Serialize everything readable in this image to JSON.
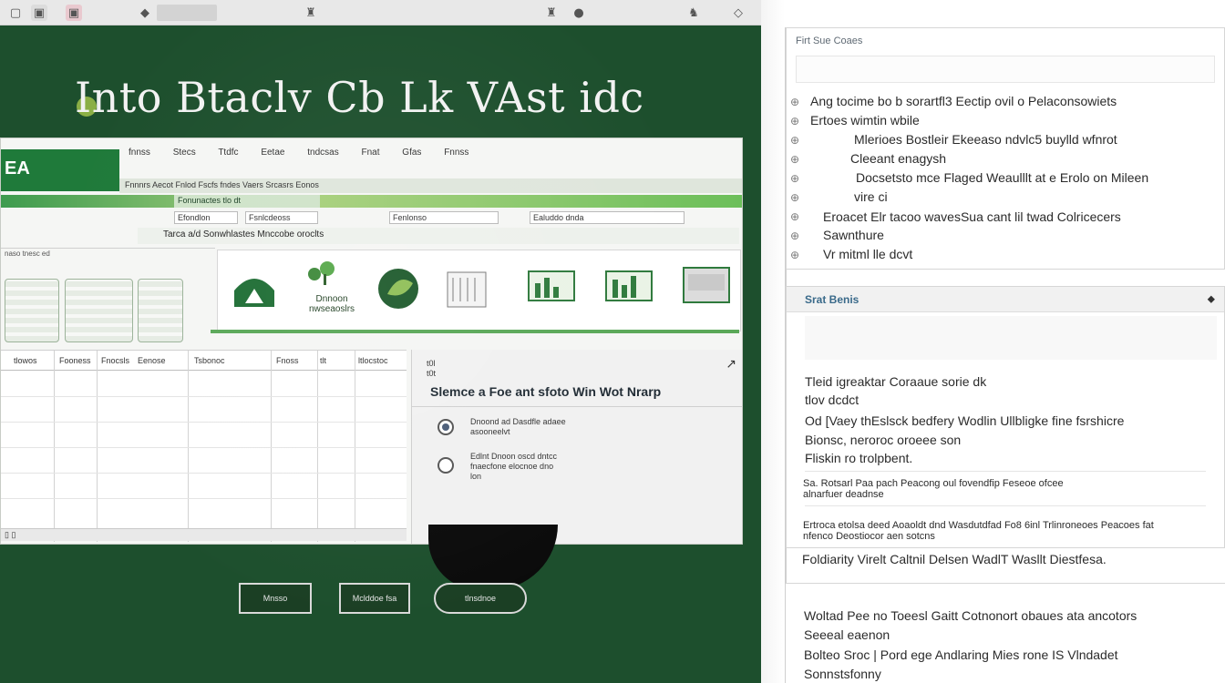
{
  "headline": "Into Btaclv Cb Lk VAst idc",
  "topbar": {
    "icons": [
      "app-icon",
      "tile-icon",
      "tile-icon",
      "bell-icon",
      "pin-icon",
      "bookmark-icon",
      "settings-icon",
      "lamp-icon",
      "menu-icon"
    ]
  },
  "app": {
    "logo_text": "EA",
    "menu": [
      "fnnss",
      "Stecs",
      "Ttdfc",
      "Eetae",
      "tndcsas",
      "Fnat",
      "Gfas",
      "Fnnss"
    ],
    "ribbon": "Fnnnrs   Aecot   Fnlod    Fscfs   fndes   Vaers   Srcasrs   Eonos",
    "tab": "Fonunactes   tlo   dt",
    "fields": [
      "Efondlon",
      "Fsnlcdeoss",
      "Fenlonso",
      "Ealuddo dnda"
    ],
    "subtitle": "Tarca a/d Sonwhlastes Mnccobe oroclts",
    "grid_head": "naso   tnesc   ed",
    "card_caption": "Dnnoon\nnwseaoslrs",
    "table_headers": [
      "tlowos",
      "Fooness",
      "Fnocsls",
      "Eenose",
      "Tsbonoc",
      "Fnoss",
      "tlt",
      "ltlocstoc"
    ],
    "table_footer": "▯ ▯",
    "panel": {
      "step": "t0l\nt0t",
      "title": "Slemce a Foe ant sfoto Win Wot Nrarp",
      "row1": "Dnoond ad Dasdfle adaee\nasooneelvt",
      "row2": "Edlnt Dnoon oscd dntcc\nfnaecfone elocnoe dno\nlon"
    },
    "bottom_buttons": [
      "Mnsso",
      "Mclddoe fsa",
      "tlnsdnoe"
    ]
  },
  "doc": {
    "section1": {
      "title": "Firt Sue Coaes",
      "lines": [
        "Ang tocime bo b sorartfl3 Eectip ovil o Pelaconsowiets",
        "Ertoes wimtin wbile",
        "Mlerioes Bostleir Ekeeaso ndvlc5 buylld wfnrot",
        "Cleeant enagysh",
        "Docsetsto mce Flaged Weaulllt at e Erolo on Mileen",
        "vire ci",
        "Eroacet Elr tacoo wavesSua cant lil twad Colricecers",
        "Sawnthure",
        "Vr mitml lle dcvt"
      ]
    },
    "section2": {
      "title": "Srat Benis",
      "lines": [
        "Tleid igreaktar Coraaue sorie dk",
        "tlov dcdct",
        "Od [Vaey thEslsck bedfery Wodlin Ullbligke fine fsrshicre",
        "Bionsc, neroroc oroeee son",
        "Fliskin ro trolpbent."
      ],
      "small_lines": [
        "Sa. Rotsarl Paa pach Peacong oul fovendfip Feseoe ofcee",
        "alnarfuer deadnse",
        "Ertroca etolsa deed Aoaoldt dnd Wasdutdfad Fo8 6inl Trlinroneoes Peacoes fat",
        "nfenco Deostiocor aen sotcns"
      ],
      "last_line": "Foldiarity Virelt Caltnil Delsen WadlT Wasllt Diestfesa."
    },
    "section3": {
      "lines": [
        "Woltad Pee no Toeesl Gaitt Cotnonort obaues ata ancotors",
        "Seeeal eaenon",
        "Bolteo Sroc | Pord ege Andlaring Mies rone IS Vlndadet",
        "Sonnstsfonny"
      ]
    }
  }
}
